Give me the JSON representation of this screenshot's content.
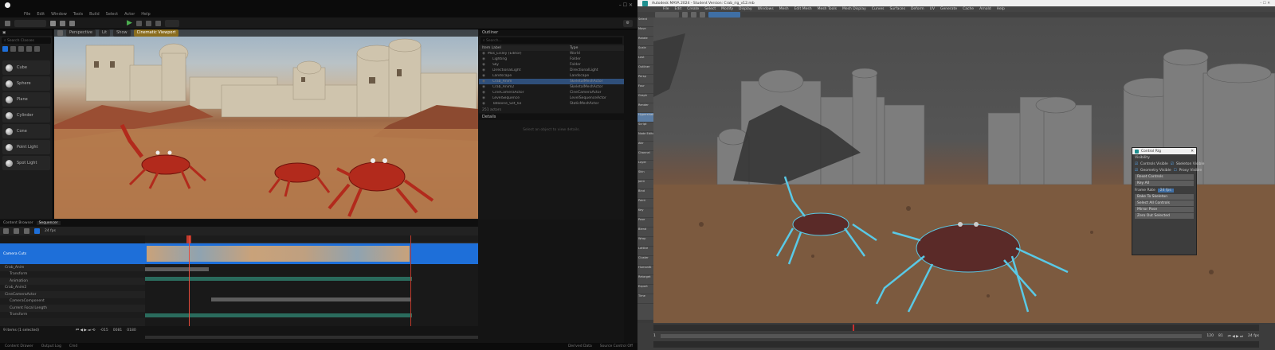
{
  "ue": {
    "menu": [
      "File",
      "Edit",
      "Window",
      "Tools",
      "Build",
      "Select",
      "Actor",
      "Help"
    ],
    "place_actors": {
      "search_placeholder": "Search Classes",
      "items": [
        "Cube",
        "Sphere",
        "Plane",
        "Cylinder",
        "Cone",
        "Point Light",
        "Spot Light"
      ]
    },
    "viewport": {
      "perspective": "Perspective",
      "lit": "Lit",
      "show": "Show",
      "cinematic": "Cinematic Viewport"
    },
    "outliner": {
      "title": "Outliner",
      "search_placeholder": "Search...",
      "col_label": "Item Label",
      "col_type": "Type",
      "rows": [
        {
          "label": "Mos_Eisley (Editor)",
          "type": "World"
        },
        {
          "label": "Lighting",
          "type": "Folder"
        },
        {
          "label": "Sky",
          "type": "Folder"
        },
        {
          "label": "DirectionalLight",
          "type": "DirectionalLight"
        },
        {
          "label": "Landscape",
          "type": "Landscape"
        },
        {
          "label": "Crab_Anim",
          "type": "SkeletalMeshActor"
        },
        {
          "label": "Crab_Anim2",
          "type": "SkeletalMeshActor"
        },
        {
          "label": "CineCameraActor",
          "type": "CineCameraActor"
        },
        {
          "label": "LevelSequence",
          "type": "LevelSequenceActor"
        },
        {
          "label": "Tatooine_Set_02",
          "type": "StaticMeshActor"
        }
      ],
      "count": "251 actors"
    },
    "details": {
      "title": "Details",
      "select_msg": "Select an object to view details."
    },
    "sequencer": {
      "tabs": [
        "Content Browser",
        "Sequencer"
      ],
      "fps": "24 fps",
      "tracks": [
        "Camera Cuts",
        "Crab_Anim",
        "Transform",
        "Animation",
        "Crab_Anim2",
        "CineCameraActor",
        "CameraComponent",
        "Current Focal Length",
        "Transform"
      ],
      "frame": "0081",
      "start": "-015",
      "end": "0180",
      "items_text": "9 items (1 selected)"
    },
    "status": [
      "Content Drawer",
      "Output Log",
      "Cmd",
      "Derived Data",
      "Source Control Off"
    ]
  },
  "maya": {
    "title": "Autodesk MAYA 2024 - Student Version: Crab_rig_v12.mb",
    "menu": [
      "File",
      "Edit",
      "Create",
      "Select",
      "Modify",
      "Display",
      "Windows",
      "Mesh",
      "Edit Mesh",
      "Mesh Tools",
      "Mesh Display",
      "Curves",
      "Surfaces",
      "Deform",
      "UV",
      "Generate",
      "Cache",
      "Arnold",
      "Help"
    ],
    "left_items": [
      "Select",
      "Move",
      "Rotate",
      "Scale",
      "Last",
      "Outliner",
      "Persp",
      "Four",
      "Graph",
      "Render",
      "Hypershade",
      "Script",
      "Node Editor",
      "Attr",
      "Channel",
      "Layer",
      "Skin",
      "Joint",
      "Bind",
      "Paint",
      "Key",
      "Pose",
      "Blend",
      "Wrap",
      "Lattice",
      "Cluster",
      "HumanIK",
      "Retarget",
      "Export",
      "Time"
    ],
    "panel": {
      "title": "Control Rig",
      "section": "Visibility",
      "checks": [
        "Controls Visible",
        "Skeleton Visible",
        "Geometry Visible",
        "Proxy Visible"
      ],
      "buttons": [
        "Reset Controls",
        "Key All",
        "Bake To Skeleton",
        "Select All Controls",
        "Mirror Pose",
        "Zero Out Selected"
      ],
      "fps_label": "Frame Rate",
      "fps_value": "24 fps"
    },
    "timeline": {
      "start": "1",
      "end": "120",
      "current": "81",
      "fps": "24 fps"
    }
  }
}
